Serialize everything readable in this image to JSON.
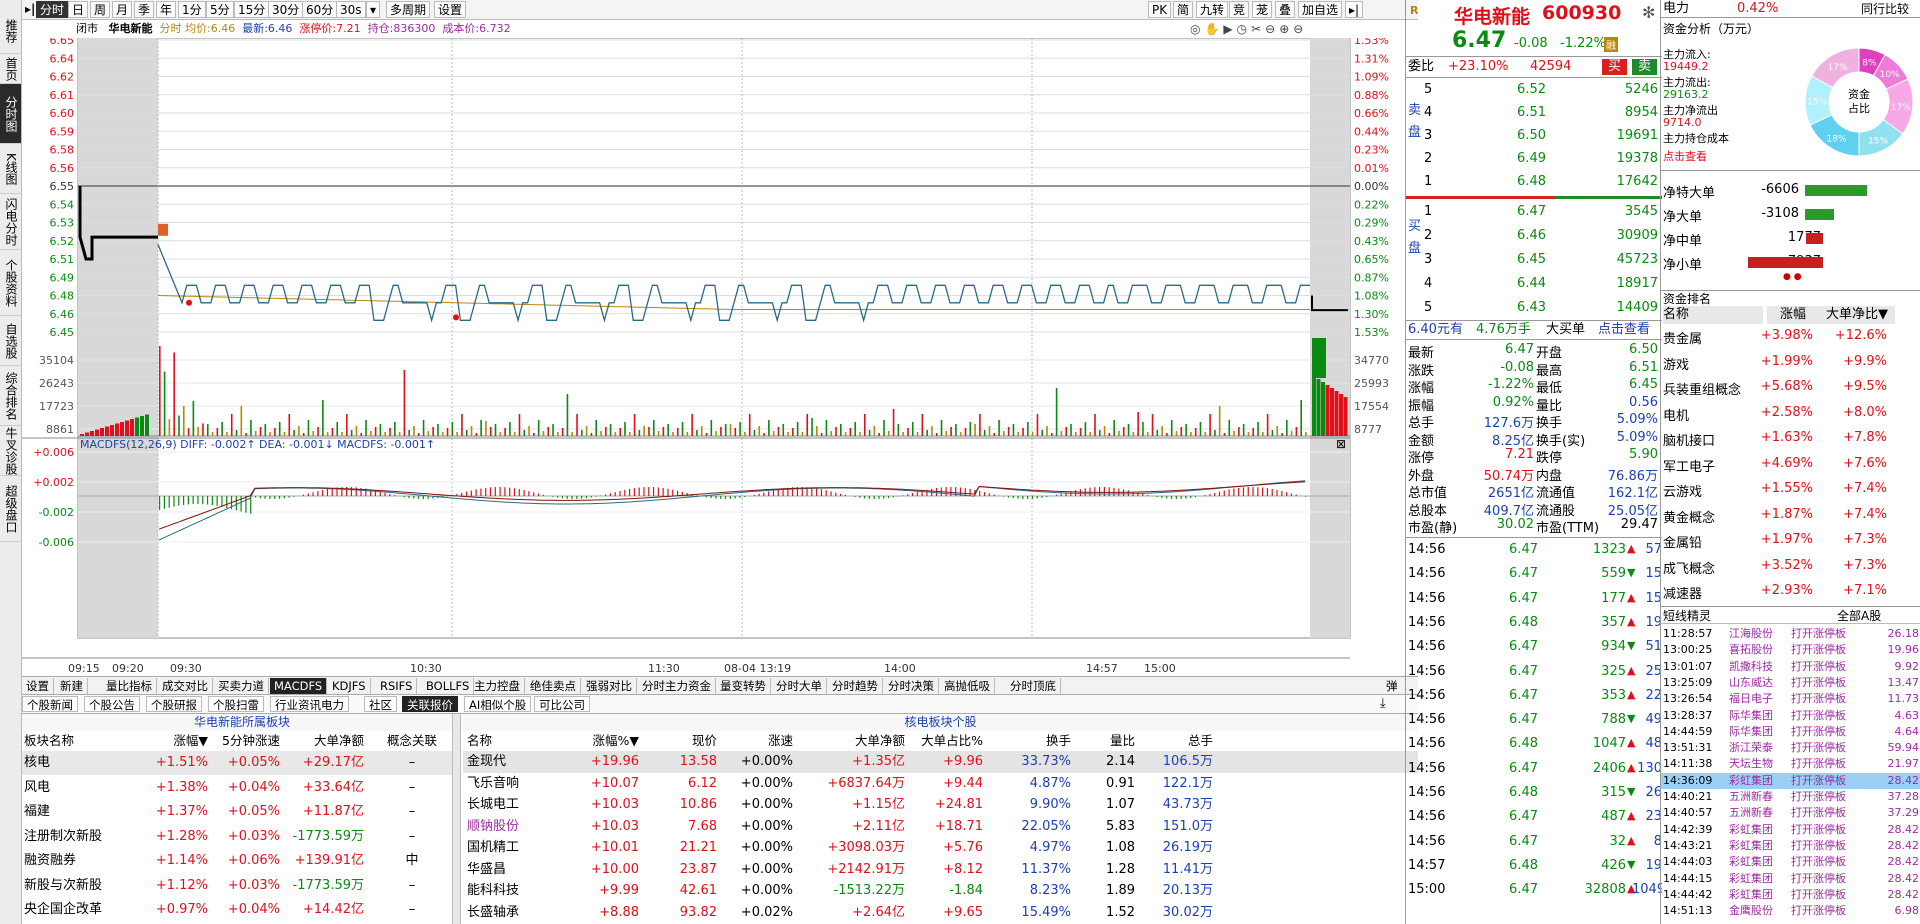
{
  "sidebar": {
    "items": [
      {
        "label": "推荐",
        "active": false
      },
      {
        "label": "首页",
        "active": false
      },
      {
        "label": "分时图",
        "active": true
      },
      {
        "label": "K线图",
        "active": false
      },
      {
        "label": "闪电分时",
        "active": false
      },
      {
        "label": "个股资料",
        "active": false
      },
      {
        "label": "自选股",
        "active": false
      },
      {
        "label": "综合排名",
        "active": false
      },
      {
        "label": "牛叉诊股",
        "active": false
      },
      {
        "label": "超级盘口",
        "active": false
      }
    ]
  },
  "toolbar": {
    "left_icon": "▸|",
    "items": [
      "分时",
      "日",
      "周",
      "月",
      "季",
      "年",
      "1分",
      "5分",
      "15分",
      "30分",
      "60分",
      "30s",
      "▾",
      "多周期",
      "设置"
    ],
    "right_items": [
      "PK",
      "简",
      "九转",
      "竞",
      "茏",
      "叠",
      "加自选",
      "▸|"
    ]
  },
  "infobar": {
    "market": "闭市",
    "name": "华电新能",
    "legend_label": "分时",
    "avg": "均价:6.46",
    "latest_label": "最新:",
    "latest": "6.46",
    "limit_label": "涨停价:",
    "limit": "7.21",
    "hold_label": "持仓:",
    "hold": "836300",
    "cost_label": "成本价:",
    "cost": "6.732"
  },
  "chart": {
    "price_ticks": [
      "6.65",
      "6.64",
      "6.62",
      "6.61",
      "6.60",
      "6.59",
      "6.58",
      "6.56",
      "6.55",
      "6.54",
      "6.53",
      "6.52",
      "6.51",
      "6.49",
      "6.48",
      "6.46",
      "6.45"
    ],
    "pct_ticks": [
      "1.53%",
      "1.31%",
      "1.09%",
      "0.88%",
      "0.66%",
      "0.44%",
      "0.23%",
      "0.01%",
      "0.00%",
      "0.22%",
      "0.29%",
      "0.43%",
      "0.65%",
      "0.87%",
      "1.08%",
      "1.30%",
      "1.53%"
    ],
    "vol_ticks_left": [
      "35104",
      "26243",
      "17723",
      "8861"
    ],
    "vol_ticks_right": [
      "34770",
      "25993",
      "17554",
      "8777"
    ],
    "macd_title": "MACDFS(12,26,9) DIFF: -0.002↑ DEA: -0.001↓ MACDFS: -0.001↑",
    "macd_ticks": [
      "+0.006",
      "+0.002",
      "-0.002",
      "-0.006"
    ],
    "time_labels": [
      "09:15",
      "09:20",
      "09:30",
      "10:30",
      "11:30",
      "08-04 13:19",
      "14:00",
      "14:57",
      "15:00"
    ],
    "colors": {
      "up": "#e0101a",
      "down": "#0a8a12",
      "price": "#2a6a88",
      "avg": "#b8860b"
    }
  },
  "tabs1": [
    "设置",
    "新建",
    "量比指标",
    "成交对比",
    "买卖力道",
    "MACDFS",
    "KDJFS",
    "RSIFS",
    "BOLLFS",
    "主力控盘",
    "绝佳卖点",
    "强弱对比",
    "分时主力资金",
    "量变转势",
    "分时大单",
    "分时趋势",
    "分时决策",
    "高抛低吸",
    "分时顶底"
  ],
  "tabs1_active": "MACDFS",
  "tabs1_right": "弹",
  "tabs2": [
    "个股新闻",
    "个股公告",
    "个股研报",
    "个股扫雷",
    "行业资讯电力",
    "社区",
    "关联报价",
    "AI相似个股",
    "可比公司"
  ],
  "tabs2_active": "关联报价",
  "sector": {
    "title": "华电新能所属板块",
    "headers": [
      "板块名称",
      "涨幅▼",
      "5分钟涨速",
      "大单净额",
      "概念关联"
    ],
    "rows": [
      [
        "核电",
        "+1.51%",
        "+0.05%",
        "+29.17亿",
        "–"
      ],
      [
        "风电",
        "+1.38%",
        "+0.04%",
        "+33.64亿",
        "–"
      ],
      [
        "福建",
        "+1.37%",
        "+0.05%",
        "+11.87亿",
        "–"
      ],
      [
        "注册制次新股",
        "+1.28%",
        "+0.03%",
        "-1773.59万",
        "–"
      ],
      [
        "融资融券",
        "+1.14%",
        "+0.06%",
        "+139.91亿",
        "中"
      ],
      [
        "新股与次新股",
        "+1.12%",
        "+0.03%",
        "-1773.59万",
        "–"
      ],
      [
        "央企国企改革",
        "+0.97%",
        "+0.04%",
        "+14.42亿",
        "–"
      ]
    ]
  },
  "stocks": {
    "title": "核电板块个股",
    "headers": [
      "名称",
      "涨幅%▼",
      "现价",
      "涨速",
      "大单净额",
      "大单占比%",
      "换手",
      "量比",
      "总手"
    ],
    "rows": [
      [
        "金现代",
        "+19.96",
        "13.58",
        "+0.00%",
        "+1.35亿",
        "+9.96",
        "33.73%",
        "2.14",
        "106.5万"
      ],
      [
        "飞乐音响",
        "+10.07",
        "6.12",
        "+0.00%",
        "+6837.64万",
        "+9.44",
        "4.87%",
        "0.91",
        "122.1万"
      ],
      [
        "长城电工",
        "+10.03",
        "10.86",
        "+0.00%",
        "+1.15亿",
        "+24.81",
        "9.90%",
        "1.07",
        "43.73万"
      ],
      [
        "顺钠股份",
        "+10.03",
        "7.68",
        "+0.00%",
        "+2.11亿",
        "+18.71",
        "22.05%",
        "5.83",
        "151.0万"
      ],
      [
        "国机精工",
        "+10.01",
        "21.21",
        "+0.00%",
        "+3098.03万",
        "+5.76",
        "4.97%",
        "1.08",
        "26.19万"
      ],
      [
        "华盛昌",
        "+10.00",
        "23.87",
        "+0.00%",
        "+2142.91万",
        "+8.12",
        "11.37%",
        "1.28",
        "11.41万"
      ],
      [
        "能科科技",
        "+9.99",
        "42.61",
        "+0.00%",
        "-1513.22万",
        "-1.84",
        "8.23%",
        "1.89",
        "20.13万"
      ],
      [
        "长盛轴承",
        "+8.88",
        "93.82",
        "+0.02%",
        "+2.64亿",
        "+9.65",
        "15.49%",
        "1.52",
        "30.02万"
      ]
    ]
  },
  "quote": {
    "logo": "R",
    "name": "华电新能",
    "code": "600930",
    "price": "6.47",
    "change": "-0.08",
    "pct": "-1.22%",
    "badge": "融",
    "weibi_label": "委比",
    "weibi": "+23.10%",
    "weicha": "42594",
    "buy_btn": "买",
    "sell_btn": "卖",
    "sell_label": "卖盘",
    "buy_label": "买盘",
    "asks": [
      [
        "5",
        "6.52",
        "5246"
      ],
      [
        "4",
        "6.51",
        "8954"
      ],
      [
        "3",
        "6.50",
        "19691"
      ],
      [
        "2",
        "6.49",
        "19378"
      ],
      [
        "1",
        "6.48",
        "17642"
      ]
    ],
    "bids": [
      [
        "1",
        "6.47",
        "3545"
      ],
      [
        "2",
        "6.46",
        "30909"
      ],
      [
        "3",
        "6.45",
        "45723"
      ],
      [
        "4",
        "6.44",
        "18917"
      ],
      [
        "5",
        "6.43",
        "14409"
      ]
    ],
    "bigbuy": {
      "price": "6.40元有",
      "amount": "4.76万手",
      "label": "大买单",
      "link": "点击查看"
    },
    "stats": [
      [
        "最新",
        "6.47",
        "开盘",
        "6.50"
      ],
      [
        "涨跌",
        "-0.08",
        "最高",
        "6.51"
      ],
      [
        "涨幅",
        "-1.22%",
        "最低",
        "6.45"
      ],
      [
        "振幅",
        "0.92%",
        "量比",
        "0.56"
      ],
      [
        "总手",
        "127.6万",
        "换手",
        "5.09%"
      ],
      [
        "金额",
        "8.25亿",
        "换手(实)",
        "5.09%"
      ],
      [
        "涨停",
        "7.21",
        "跌停",
        "5.90"
      ],
      [
        "外盘",
        "50.74万",
        "内盘",
        "76.86万"
      ],
      [
        "总市值",
        "2651亿",
        "流通值",
        "162.1亿"
      ],
      [
        "总股本",
        "409.7亿",
        "流通股",
        "25.05亿"
      ],
      [
        "市盈(静)",
        "30.02",
        "市盈(TTM)",
        "29.47"
      ]
    ],
    "ticks": [
      [
        "14:56",
        "6.47",
        "1323",
        "57"
      ],
      [
        "14:56",
        "6.47",
        "559",
        "15"
      ],
      [
        "14:56",
        "6.47",
        "177",
        "15"
      ],
      [
        "14:56",
        "6.48",
        "357",
        "19"
      ],
      [
        "14:56",
        "6.47",
        "934",
        "51"
      ],
      [
        "14:56",
        "6.47",
        "325",
        "25"
      ],
      [
        "14:56",
        "6.47",
        "353",
        "22"
      ],
      [
        "14:56",
        "6.47",
        "788",
        "49"
      ],
      [
        "14:56",
        "6.48",
        "1047",
        "48"
      ],
      [
        "14:56",
        "6.47",
        "2406",
        "130"
      ],
      [
        "14:56",
        "6.48",
        "315",
        "26"
      ],
      [
        "14:56",
        "6.47",
        "487",
        "23"
      ],
      [
        "14:56",
        "6.47",
        "32",
        "8"
      ],
      [
        "14:57",
        "6.48",
        "426",
        "19"
      ],
      [
        "15:00",
        "6.47",
        "32808",
        "1049"
      ]
    ]
  },
  "fund": {
    "sector_label": "电力",
    "sector_pct": "0.42%",
    "sector_more": "同行比较",
    "title": "资金分析（万元）",
    "lines": [
      "主力流入:",
      "19449.2",
      "主力流出:",
      "29163.2",
      "主力净流出",
      "9714.0",
      "主力持仓成本"
    ],
    "link": "点击查看",
    "donut_center": "资金占比",
    "donut_labels": [
      "8%",
      "10%",
      "17%",
      "15%",
      "18%",
      "15%",
      "17%"
    ],
    "net": [
      [
        "净特大单",
        "-6606"
      ],
      [
        "净大单",
        "-3108"
      ],
      [
        "净中单",
        "1777"
      ],
      [
        "净小单",
        "7937"
      ]
    ],
    "net_values": [
      -6606,
      -3108,
      1777,
      7937
    ],
    "rank_title": "资金排名",
    "rank_headers": [
      "名称",
      "涨幅",
      "大单净比▼"
    ],
    "rank": [
      [
        "贵金属",
        "+3.98%",
        "+12.6%"
      ],
      [
        "游戏",
        "+1.99%",
        "+9.9%"
      ],
      [
        "兵装重组概念",
        "+5.68%",
        "+9.5%"
      ],
      [
        "电机",
        "+2.58%",
        "+8.0%"
      ],
      [
        "脑机接口",
        "+1.63%",
        "+7.8%"
      ],
      [
        "军工电子",
        "+4.69%",
        "+7.6%"
      ],
      [
        "云游戏",
        "+1.55%",
        "+7.4%"
      ],
      [
        "黄金概念",
        "+1.87%",
        "+7.4%"
      ],
      [
        "金属铅",
        "+1.97%",
        "+7.3%"
      ],
      [
        "成飞概念",
        "+3.52%",
        "+7.3%"
      ],
      [
        "减速器",
        "+2.93%",
        "+7.1%"
      ]
    ],
    "elf_title": "短线精灵",
    "elf_filter": "全部A股",
    "elf": [
      [
        "11:28:57",
        "江海股份",
        "打开涨停板",
        "26.18"
      ],
      [
        "13:00:25",
        "喜拓股份",
        "打开涨停板",
        "19.96"
      ],
      [
        "13:01:07",
        "凯撒科技",
        "打开涨停板",
        "9.92"
      ],
      [
        "13:25:09",
        "山东威达",
        "打开涨停板",
        "13.47"
      ],
      [
        "13:26:54",
        "福日电子",
        "打开涨停板",
        "11.73"
      ],
      [
        "13:28:37",
        "际华集团",
        "打开涨停板",
        "4.63"
      ],
      [
        "14:44:59",
        "际华集团",
        "打开涨停板",
        "4.64"
      ],
      [
        "13:51:31",
        "浙江荣泰",
        "打开涨停板",
        "59.94"
      ],
      [
        "14:11:38",
        "天坛生物",
        "打开涨停板",
        "21.97"
      ],
      [
        "14:36:09",
        "彩虹集团",
        "打开涨停板",
        "28.42"
      ],
      [
        "14:40:21",
        "五洲新春",
        "打开涨停板",
        "37.28"
      ],
      [
        "14:40:57",
        "五洲新春",
        "打开涨停板",
        "37.29"
      ],
      [
        "14:42:39",
        "彩虹集团",
        "打开涨停板",
        "28.42"
      ],
      [
        "14:43:21",
        "彩虹集团",
        "打开涨停板",
        "28.42"
      ],
      [
        "14:44:03",
        "彩虹集团",
        "打开涨停板",
        "28.42"
      ],
      [
        "14:44:15",
        "彩虹集团",
        "打开涨停板",
        "28.42"
      ],
      [
        "14:44:42",
        "彩虹集团",
        "打开涨停板",
        "28.42"
      ],
      [
        "14:51:13",
        "金鹰股份",
        "打开涨停板",
        "6.98"
      ]
    ],
    "elf_highlight": 9
  }
}
